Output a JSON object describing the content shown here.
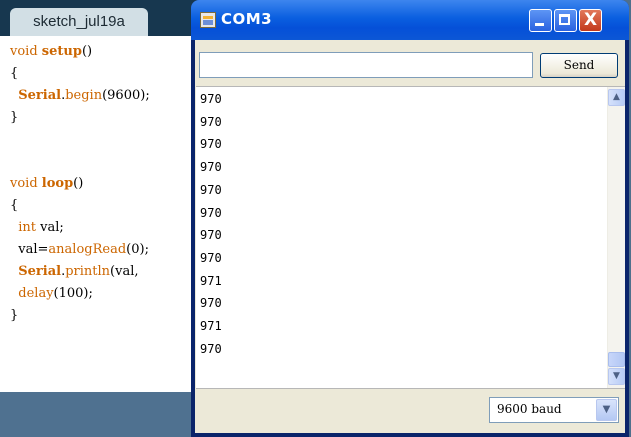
{
  "ide": {
    "tab_label": "sketch_jul19a",
    "code": [
      [
        {
          "t": "void ",
          "c": "kw"
        },
        {
          "t": "setup",
          "c": "kwb"
        },
        {
          "t": "()",
          "c": "plain"
        }
      ],
      [
        {
          "t": "{",
          "c": "plain"
        }
      ],
      [
        {
          "t": "  ",
          "c": "plain"
        },
        {
          "t": "Serial",
          "c": "kwb"
        },
        {
          "t": ".",
          "c": "plain"
        },
        {
          "t": "begin",
          "c": "kw"
        },
        {
          "t": "(9600);",
          "c": "plain"
        }
      ],
      [
        {
          "t": "}",
          "c": "plain"
        }
      ],
      [],
      [],
      [
        {
          "t": "void ",
          "c": "kw"
        },
        {
          "t": "loop",
          "c": "kwb"
        },
        {
          "t": "()",
          "c": "plain"
        }
      ],
      [
        {
          "t": "{",
          "c": "plain"
        }
      ],
      [
        {
          "t": "  ",
          "c": "plain"
        },
        {
          "t": "int",
          "c": "kw"
        },
        {
          "t": " val;",
          "c": "plain"
        }
      ],
      [
        {
          "t": "  val=",
          "c": "plain"
        },
        {
          "t": "analogRead",
          "c": "kw"
        },
        {
          "t": "(0);",
          "c": "plain"
        }
      ],
      [
        {
          "t": "  ",
          "c": "plain"
        },
        {
          "t": "Serial",
          "c": "kwb"
        },
        {
          "t": ".",
          "c": "plain"
        },
        {
          "t": "println",
          "c": "kw"
        },
        {
          "t": "(val,",
          "c": "plain"
        }
      ],
      [
        {
          "t": "  ",
          "c": "plain"
        },
        {
          "t": "delay",
          "c": "kw"
        },
        {
          "t": "(100);",
          "c": "plain"
        }
      ],
      [
        {
          "t": "}",
          "c": "plain"
        }
      ]
    ]
  },
  "monitor": {
    "title": "COM3",
    "close_glyph": "X",
    "send_input": {
      "value": "",
      "placeholder": ""
    },
    "send_label": "Send",
    "output_lines": [
      "970",
      "970",
      "970",
      "970",
      "970",
      "970",
      "970",
      "970",
      "971",
      "970",
      "971",
      "970"
    ],
    "baud": "9600 baud",
    "scroll_up_glyph": "▲",
    "scroll_down_glyph": "▼",
    "dropdown_glyph": "▼"
  },
  "colors": {
    "titlebar_blue": "#0a5fe0",
    "close_red": "#c2391c",
    "ide_header": "#17374f",
    "keyword": "#cc6600"
  }
}
